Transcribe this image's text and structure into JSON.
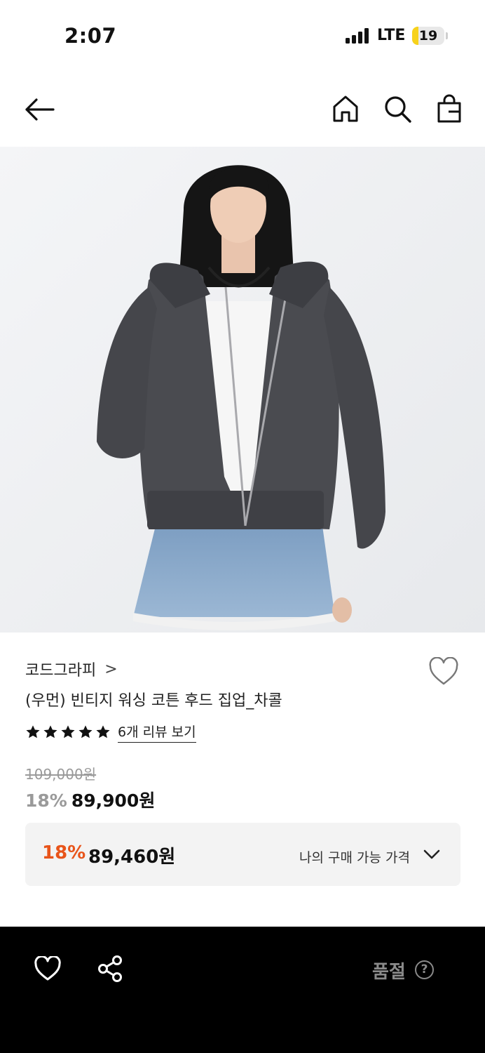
{
  "status_bar": {
    "time": "2:07",
    "network": "LTE",
    "battery": "19",
    "battery_level": 0.19
  },
  "nav": {
    "icons": [
      "back-icon",
      "home-icon",
      "search-icon",
      "shopping-bag-icon"
    ]
  },
  "product": {
    "brand": "코드그라피",
    "brand_chevron": ">",
    "name": "(우먼) 빈티지 워싱 코튼 후드 집업_차콜",
    "rating_stars": 5,
    "review_link": "6개 리뷰 보기",
    "original_price": "109,000원",
    "discount_pct": "18%",
    "sale_price": "89,900원"
  },
  "my_price": {
    "discount_pct": "18%",
    "price": "89,460원",
    "label": "나의 구매 가능 가격"
  },
  "bottom_bar": {
    "status": "품절",
    "help": "?"
  },
  "colors": {
    "accent": "#e8541a",
    "price_box_bg": "#f3f3f3",
    "bottom_bar_bg": "#000000",
    "muted": "#9a9a9a"
  }
}
